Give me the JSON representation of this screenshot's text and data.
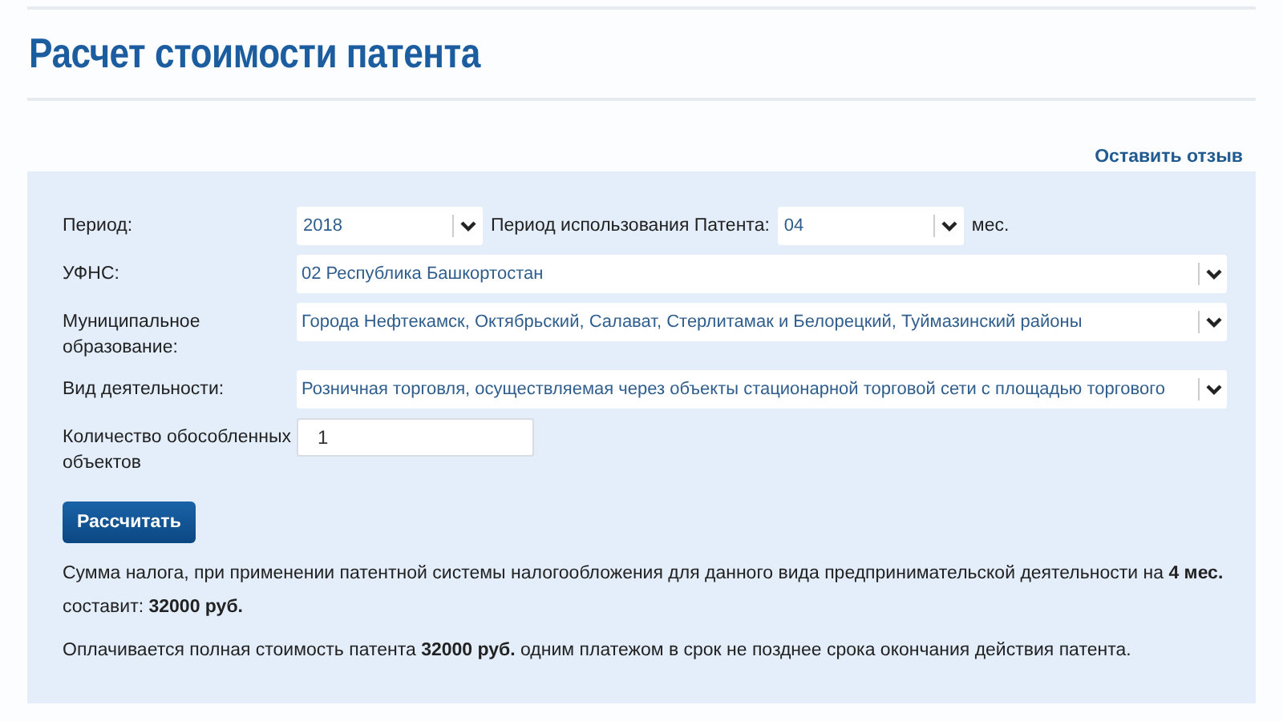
{
  "title": "Расчет стоимости патента",
  "feedback_link": "Оставить отзыв",
  "form": {
    "rows": [
      {
        "kind": "period",
        "label": "Период:",
        "value": "2018",
        "extra_label": "Период использования Патента:",
        "extra_value": "04",
        "suffix": "мес."
      },
      {
        "kind": "select",
        "label": "УФНС:",
        "value": "02 Республика Башкортостан"
      },
      {
        "kind": "select",
        "label": "Муниципальное образование:",
        "value": "Города Нефтекамск, Октябрьский, Салават, Стерлитамак и Белорецкий, Туймазинский районы"
      },
      {
        "kind": "select",
        "label": "Вид деятельности:",
        "value": "Розничная торговля, осуществляемая через объекты стационарной торговой сети с площадью торгового"
      },
      {
        "kind": "input",
        "label": "Количество обособленных объектов",
        "value": "1"
      }
    ]
  },
  "calculate_button": "Рассчитать",
  "result": [
    "Сумма налога, при применении патентной системы налогообложения для данного вида предпринимательской деятельности на **4 мес.**\nсоставит: **32000 руб.**",
    "Оплачивается полная стоимость патента **32000 руб.** одним платежом в срок не позднее срока окончания действия патента."
  ]
}
